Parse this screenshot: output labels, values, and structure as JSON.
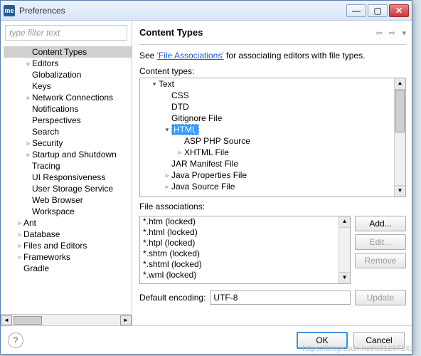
{
  "window": {
    "title": "Preferences"
  },
  "filter": {
    "placeholder": "type filter text"
  },
  "left_tree": [
    {
      "label": "Content Types",
      "indent": 2,
      "kids": false,
      "sel": true
    },
    {
      "label": "Editors",
      "indent": 2,
      "kids": true
    },
    {
      "label": "Globalization",
      "indent": 2,
      "kids": false
    },
    {
      "label": "Keys",
      "indent": 2,
      "kids": false
    },
    {
      "label": "Network Connections",
      "indent": 2,
      "kids": true
    },
    {
      "label": "Notifications",
      "indent": 2,
      "kids": false
    },
    {
      "label": "Perspectives",
      "indent": 2,
      "kids": false
    },
    {
      "label": "Search",
      "indent": 2,
      "kids": false
    },
    {
      "label": "Security",
      "indent": 2,
      "kids": true
    },
    {
      "label": "Startup and Shutdown",
      "indent": 2,
      "kids": true
    },
    {
      "label": "Tracing",
      "indent": 2,
      "kids": false
    },
    {
      "label": "UI Responsiveness",
      "indent": 2,
      "kids": false
    },
    {
      "label": "User Storage Service",
      "indent": 2,
      "kids": false
    },
    {
      "label": "Web Browser",
      "indent": 2,
      "kids": false
    },
    {
      "label": "Workspace",
      "indent": 2,
      "kids": false
    },
    {
      "label": "Ant",
      "indent": 1,
      "kids": true
    },
    {
      "label": "Database",
      "indent": 1,
      "kids": true
    },
    {
      "label": "Files and Editors",
      "indent": 1,
      "kids": true
    },
    {
      "label": "Frameworks",
      "indent": 1,
      "kids": true
    },
    {
      "label": "Gradle",
      "indent": 1,
      "kids": false
    }
  ],
  "page": {
    "heading": "Content Types",
    "desc_pre": "See ",
    "desc_link": "'File Associations'",
    "desc_post": " for associating editors with file types.",
    "ct_label": "Content types:",
    "fa_label": "File associations:",
    "enc_label": "Default encoding:",
    "enc_value": "UTF-8"
  },
  "content_tree": [
    {
      "label": "Text",
      "pad": 1,
      "tw": "▾"
    },
    {
      "label": "CSS",
      "pad": 2,
      "tw": ""
    },
    {
      "label": "DTD",
      "pad": 2,
      "tw": ""
    },
    {
      "label": "Gitignore File",
      "pad": 2,
      "tw": ""
    },
    {
      "label": "HTML",
      "pad": 2,
      "tw": "▾",
      "sel": true
    },
    {
      "label": "ASP PHP Source",
      "pad": 3,
      "tw": ""
    },
    {
      "label": "XHTML File",
      "pad": 3,
      "tw": "▹"
    },
    {
      "label": "JAR Manifest File",
      "pad": 2,
      "tw": ""
    },
    {
      "label": "Java Properties File",
      "pad": 2,
      "tw": "▹"
    },
    {
      "label": "Java Source File",
      "pad": 2,
      "tw": "▹"
    }
  ],
  "assoc": [
    "*.htm (locked)",
    "*.html (locked)",
    "*.htpl (locked)",
    "*.shtm (locked)",
    "*.shtml (locked)",
    "*.wml (locked)"
  ],
  "buttons": {
    "add": "Add...",
    "edit": "Edit...",
    "remove": "Remove",
    "update": "Update",
    "ok": "OK",
    "cancel": "Cancel"
  },
  "watermark": "https://blog.csdn.net/u01267143"
}
